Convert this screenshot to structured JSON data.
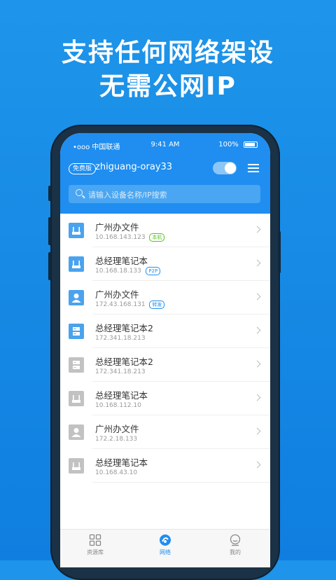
{
  "headline": {
    "line1": "支持任何网络架设",
    "line2": "无需公网IP"
  },
  "status_bar": {
    "carrier": "•ooo 中国联通",
    "time": "9:41 AM",
    "battery": "100%"
  },
  "header": {
    "badge": "免费版",
    "username": "zhiguang-oray33",
    "toggle_on": true
  },
  "search": {
    "placeholder": "请输入设备名称/IP搜索"
  },
  "devices": [
    {
      "name": "广州办文件",
      "ip": "10.168.143.123",
      "tag": "本机",
      "icon": "router-icon",
      "color": "#4aa3ee"
    },
    {
      "name": "总经理笔记本",
      "ip": "10.168.18.133",
      "tag": "P2P",
      "icon": "router-icon",
      "color": "#4aa3ee"
    },
    {
      "name": "广州办文件",
      "ip": "172.43.168.131",
      "tag": "转发",
      "icon": "user-icon",
      "color": "#4aa3ee"
    },
    {
      "name": "总经理笔记本2",
      "ip": "172.341.18.213",
      "tag": "",
      "icon": "server-icon",
      "color": "#4aa3ee"
    },
    {
      "name": "总经理笔记本2",
      "ip": "172.341.18.213",
      "tag": "",
      "icon": "server-icon",
      "color": "#c2c2c2"
    },
    {
      "name": "总经理笔记本",
      "ip": "10.168.112.10",
      "tag": "",
      "icon": "router-icon",
      "color": "#c2c2c2"
    },
    {
      "name": "广州办文件",
      "ip": "172.2.18.133",
      "tag": "",
      "icon": "user-icon",
      "color": "#c2c2c2"
    },
    {
      "name": "总经理笔记本",
      "ip": "10.168.43.10",
      "tag": "",
      "icon": "router-icon",
      "color": "#c2c2c2"
    }
  ],
  "tabs": [
    {
      "label": "资源库",
      "icon": "grid-icon"
    },
    {
      "label": "网络",
      "icon": "network-icon"
    },
    {
      "label": "我的",
      "icon": "profile-icon"
    }
  ],
  "colors": {
    "accent": "#1f8ef0",
    "tag_local": "#52c41a",
    "tag_p2p": "#1f8ef0",
    "tag_relay": "#1f8ef0"
  }
}
